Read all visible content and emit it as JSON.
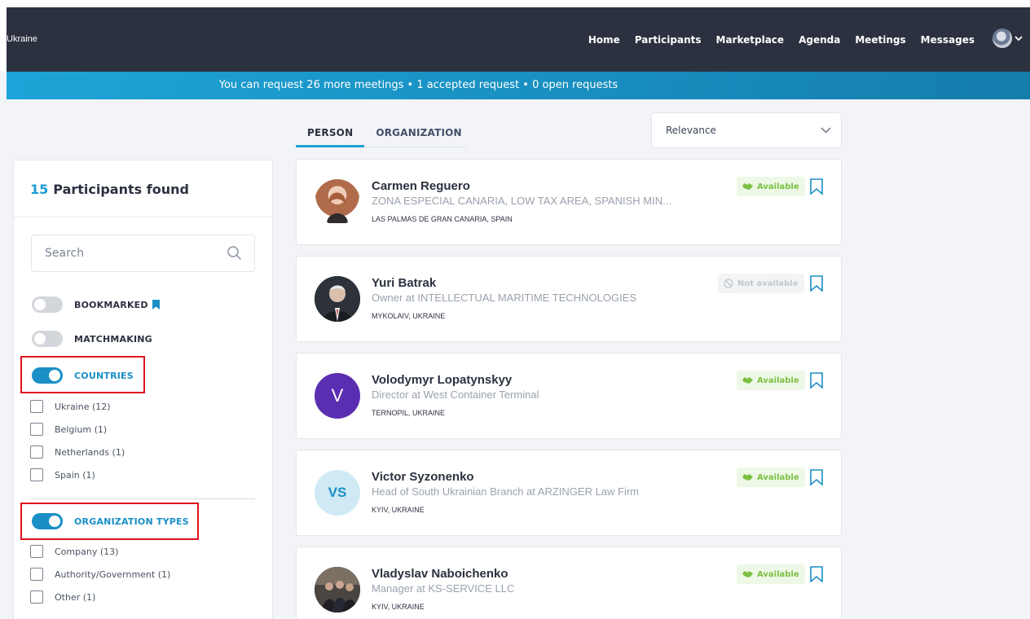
{
  "top_strip_text": "",
  "nav": {
    "brand": "Ukraine",
    "links": [
      "Home",
      "Participants",
      "Marketplace",
      "Agenda",
      "Meetings",
      "Messages"
    ]
  },
  "banner": "You can request 26 more meetings • 1 accepted request • 0 open requests",
  "tabs": [
    "PERSON",
    "ORGANIZATION"
  ],
  "sort": {
    "value": "Relevance"
  },
  "sidebar": {
    "count": "15",
    "count_label": "Participants found",
    "search_placeholder": "Search",
    "toggles": {
      "bookmarked": {
        "label": "BOOKMARKED",
        "on": false
      },
      "matchmaking": {
        "label": "MATCHMAKING",
        "on": false
      },
      "countries": {
        "label": "COUNTRIES",
        "on": true
      },
      "org_types": {
        "label": "ORGANIZATION TYPES",
        "on": true
      }
    },
    "countries": [
      "Ukraine (12)",
      "Belgium (1)",
      "Netherlands (1)",
      "Spain (1)"
    ],
    "org_types": [
      "Company (13)",
      "Authority/Government (1)",
      "Other (1)"
    ]
  },
  "participants": [
    {
      "name": "Carmen Reguero",
      "role": "ZONA ESPECIAL CANARIA, LOW TAX AREA, SPANISH MIN...",
      "location": "LAS PALMAS DE GRAN CANARIA, SPAIN",
      "status": "Available",
      "avatar": "photo"
    },
    {
      "name": "Yuri Batrak",
      "role": "Owner at INTELLECTUAL MARITIME TECHNOLOGIES",
      "location": "MYKOLAIV, UKRAINE",
      "status": "Not available",
      "avatar": "photo"
    },
    {
      "name": "Volodymyr Lopatynskyy",
      "role": "Director at West Container Terminal",
      "location": "TERNOPIL, UKRAINE",
      "status": "Available",
      "avatar": "V"
    },
    {
      "name": "Victor Syzonenko",
      "role": "Head of South Ukrainian Branch at ARZINGER Law Firm",
      "location": "KYIV, UKRAINE",
      "status": "Available",
      "avatar": "VS"
    },
    {
      "name": "Vladyslav Naboichenko",
      "role": "Manager at KS-SERVICE LLC",
      "location": "KYIV, UKRAINE",
      "status": "Available",
      "avatar": "photo"
    }
  ],
  "colors": {
    "navbar": "#2c3140",
    "accent": "#1a9cd3",
    "available": "#7bc043",
    "highlight_box": "#e0121d"
  }
}
